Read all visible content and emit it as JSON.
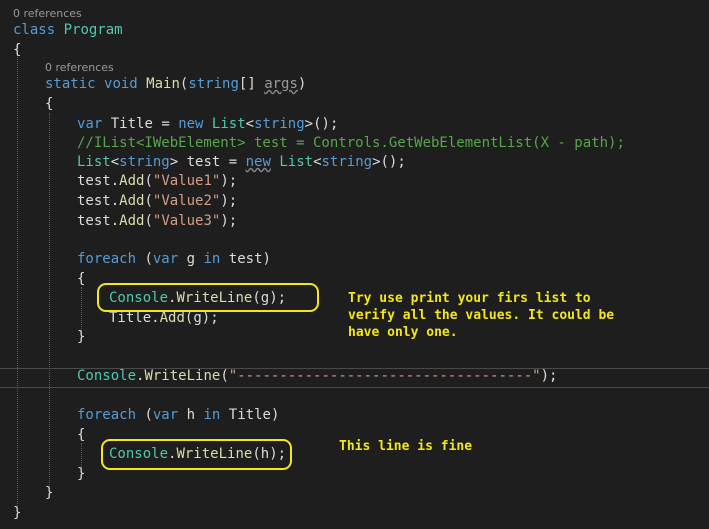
{
  "refs": {
    "class_refs": "0 references",
    "main_refs": "0 references"
  },
  "code": {
    "l_class_kw": "class",
    "l_class_name": "Program",
    "brace_open": "{",
    "brace_close": "}",
    "kw_static": "static",
    "kw_void": "void",
    "fn_main": "Main",
    "kw_string": "string",
    "args": "args",
    "kw_var": "var",
    "v_title": "Title",
    "kw_new": "new",
    "t_list": "List",
    "comment_line": "//IList<IWebElement> test = Controls.GetWebElementList(X - path);",
    "v_test": "test",
    "fn_add": "Add",
    "s_value1": "\"Value1\"",
    "s_value2": "\"Value2\"",
    "s_value3": "\"Value3\"",
    "kw_foreach": "foreach",
    "kw_in": "in",
    "v_g": "g",
    "v_h": "h",
    "t_console": "Console",
    "fn_writeline": "WriteLine",
    "s_dashes": "\"-----------------------------------\""
  },
  "annotations": {
    "note1": "Try use print your firs list to\nverify all the values. It could be\nhave only one.",
    "note2": "This line is fine"
  },
  "colors": {
    "highlight": "#f5e61a",
    "keyword": "#569cd6",
    "type": "#4ec9b0",
    "string": "#d69d85",
    "comment": "#57a64a",
    "method": "#dcdcaa"
  }
}
